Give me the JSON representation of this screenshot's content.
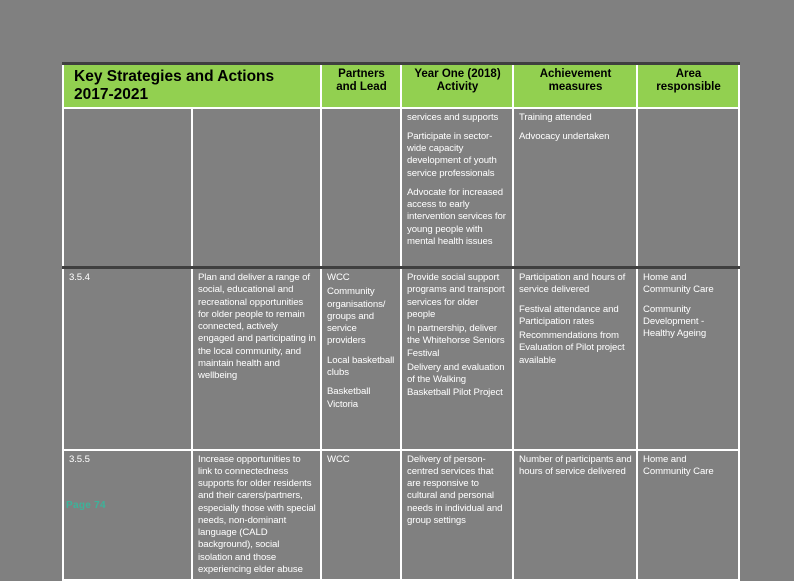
{
  "document": {
    "footer_label": "Page 74",
    "footer_color": "#3cb39a",
    "header_color": "#92d050",
    "page_background": "#808080",
    "text_color": "#ffffff"
  },
  "table": {
    "headers": {
      "main": "Key Strategies and Actions 2017-2021",
      "partners": "Partners and Lead",
      "year_one": "Year One (2018) Activity",
      "achievement": "Achievement measures",
      "area": "Area responsible"
    },
    "rows": [
      {
        "id": "",
        "description": "",
        "partners": "",
        "year_one": [
          "services and supports",
          "Participate in sector-wide capacity development of youth service professionals",
          "Advocate for increased access to early intervention services for young people with mental health issues"
        ],
        "achievement": [
          "Training attended",
          "Advocacy undertaken"
        ],
        "area": []
      },
      {
        "id": "3.5.4",
        "description": "Plan and deliver a range of social, educational and recreational opportunities for older people to remain connected, actively engaged and participating in the local community, and maintain health and wellbeing",
        "partners": [
          "WCC",
          "Community organisations/ groups and service providers",
          "Local basketball clubs",
          "Basketball Victoria"
        ],
        "year_one": [
          "Provide social support programs and transport services for older people",
          "In partnership, deliver the Whitehorse Seniors Festival",
          "Delivery and evaluation of the Walking Basketball Pilot Project"
        ],
        "achievement": [
          "Participation and hours of service delivered",
          "Festival attendance and Participation rates",
          "Recommendations from Evaluation of Pilot project available"
        ],
        "area": [
          "Home and Community Care",
          "Community Development - Healthy Ageing"
        ]
      },
      {
        "id": "3.5.5",
        "description": "Increase opportunities to link to connectedness supports for older residents and their carers/partners, especially those with special needs, non-dominant language (CALD background), social isolation and those experiencing elder abuse",
        "partners": [
          "WCC"
        ],
        "year_one": [
          "Delivery of person-centred services that are responsive to cultural and personal needs in individual and group settings"
        ],
        "achievement": [
          "Number of participants and hours of service delivered"
        ],
        "area": [
          "Home and Community Care"
        ]
      }
    ]
  }
}
